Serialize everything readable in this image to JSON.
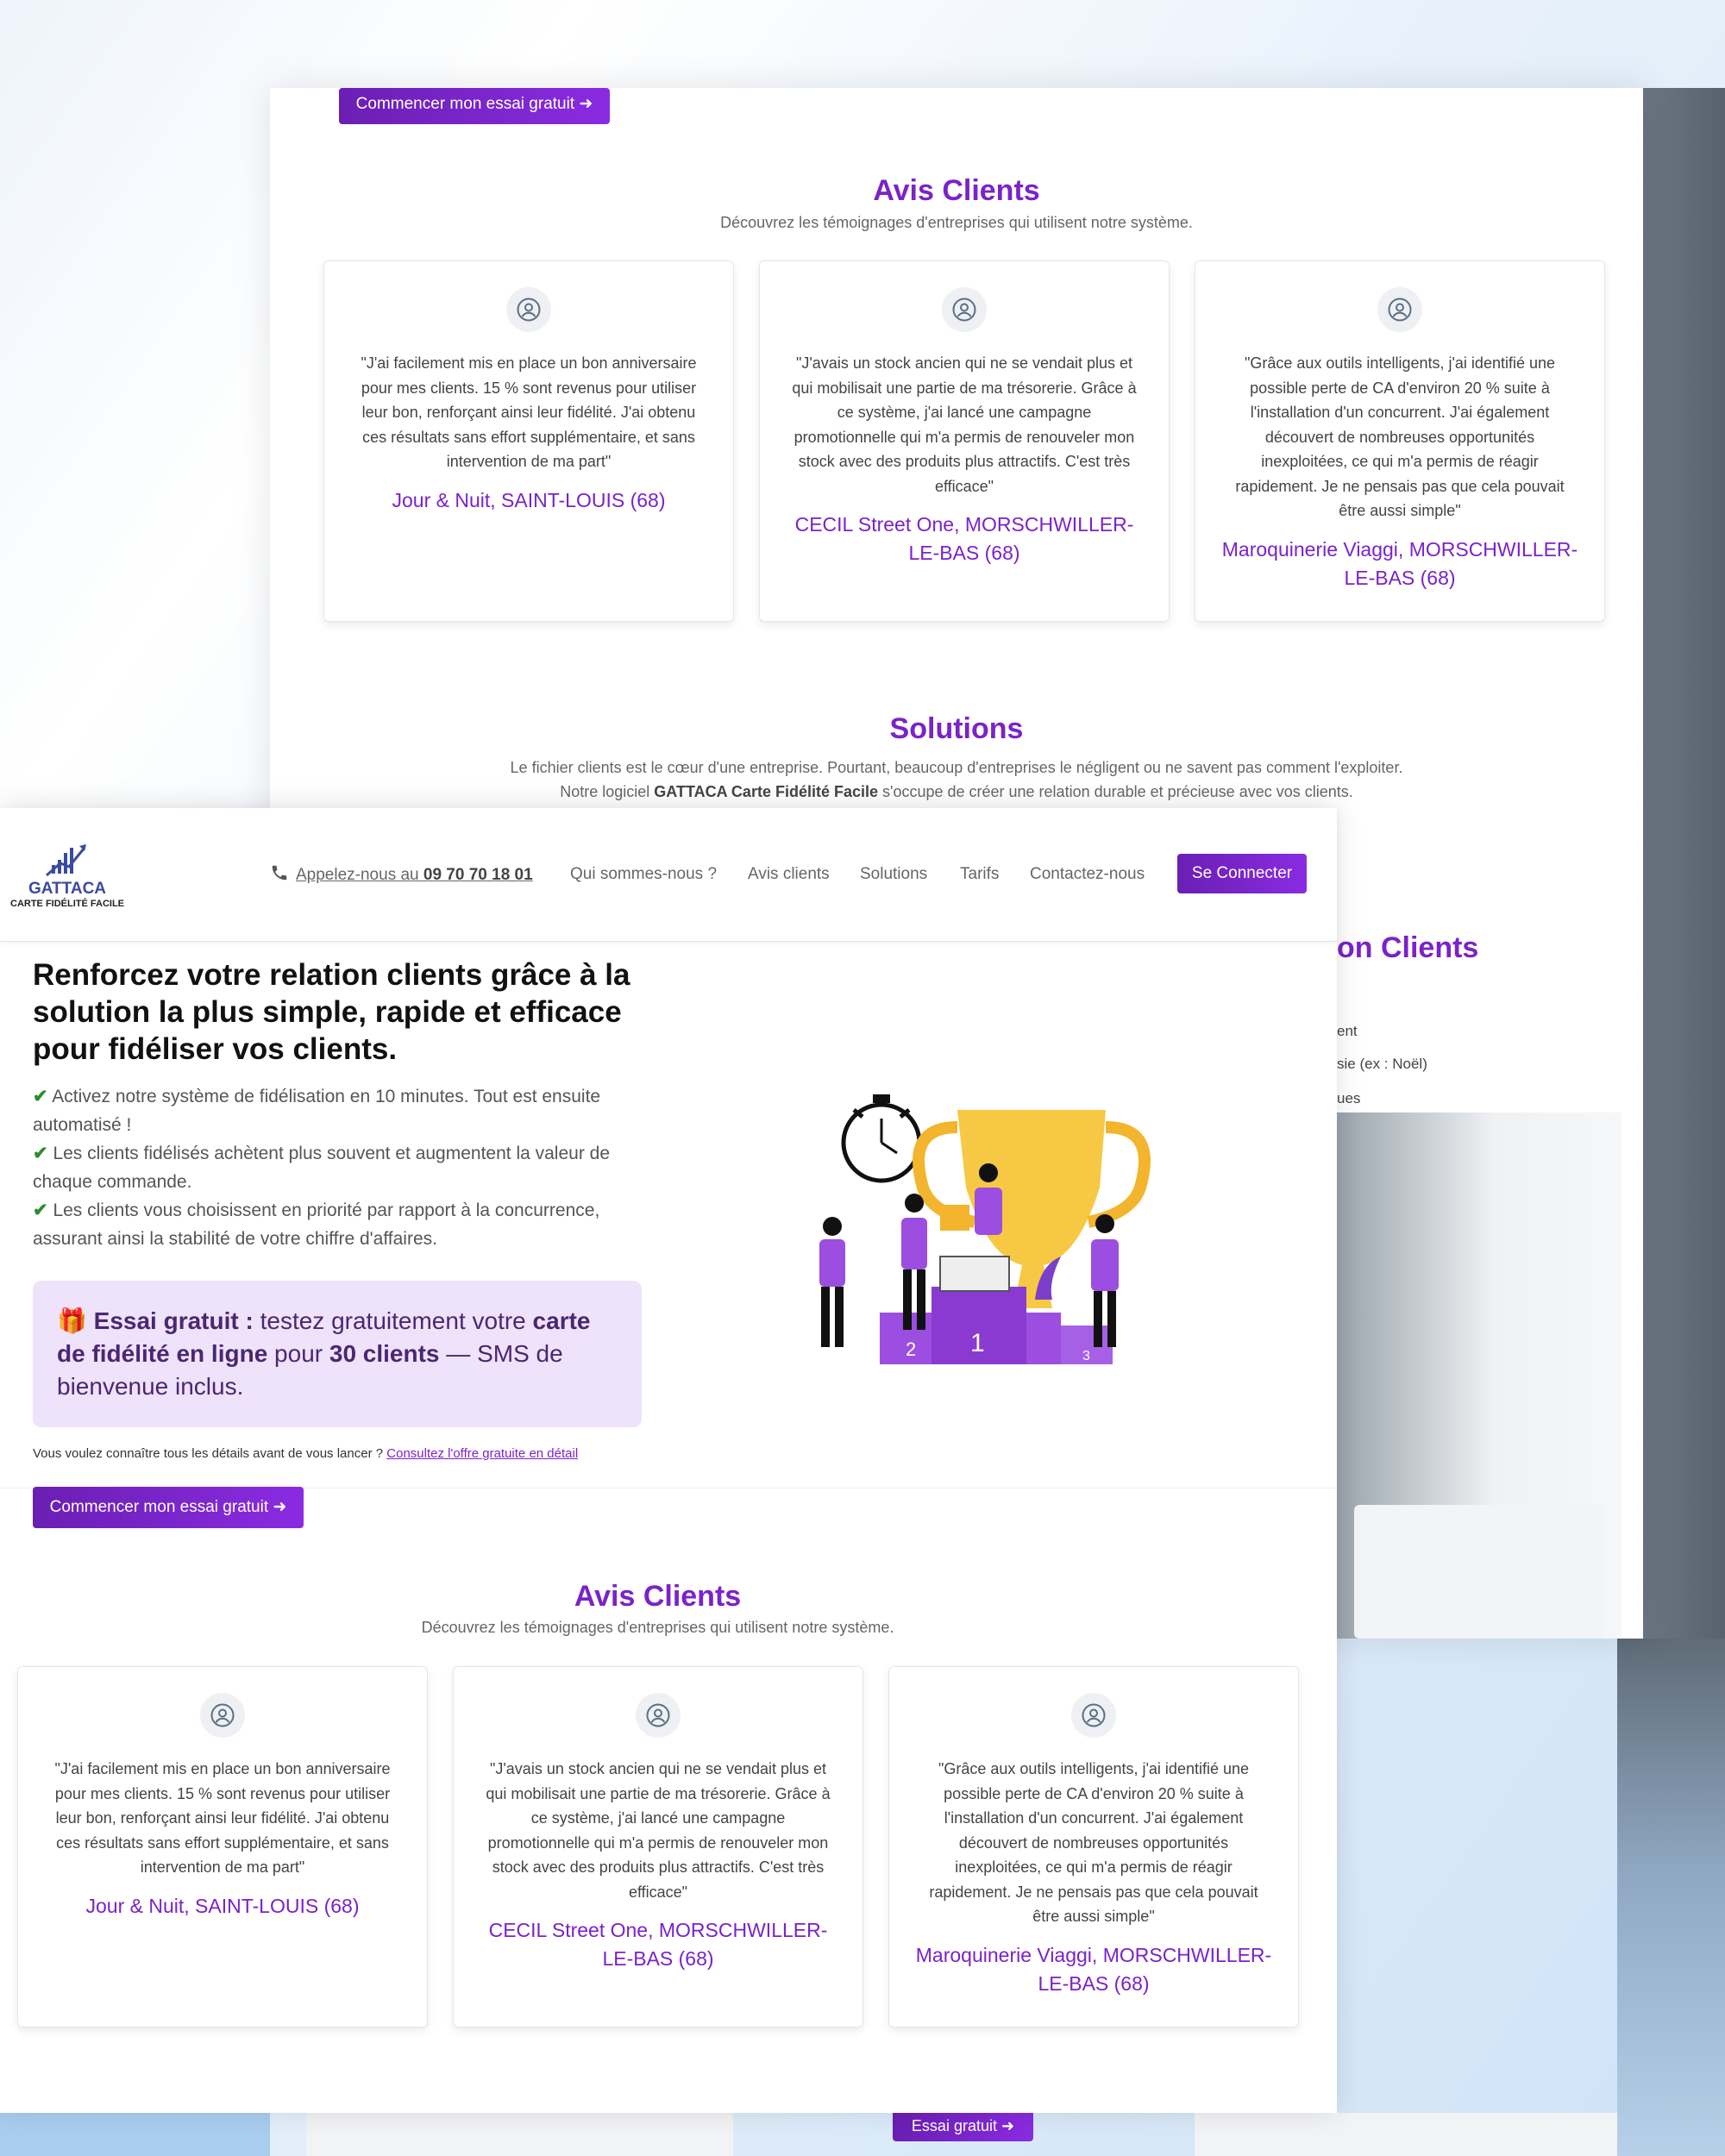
{
  "back_window": {
    "cta_label": "Commencer mon essai gratuit ➜",
    "avis_title": "Avis Clients",
    "avis_sub": "Découvrez les témoignages d'entreprises qui utilisent notre système.",
    "solutions_title": "Solutions",
    "solutions_line1": "Le fichier clients est le cœur d'une entreprise. Pourtant, beaucoup d'entreprises le négligent ou ne savent pas comment l'exploiter.",
    "solutions_line2_pre": "Notre logiciel ",
    "solutions_line2_bold": "GATTACA Carte Fidélité Facile",
    "solutions_line2_post": " s'occupe de créer une relation durable et précieuse avec vos clients.",
    "partial_title": "on Clients",
    "partial_line1": "ent",
    "partial_line2": "sie (ex : Noël)",
    "partial_line3": "ues"
  },
  "testimonials": [
    {
      "quote": "\"J'ai facilement mis en place un bon anniversaire pour mes clients. 15 % sont revenus pour utiliser leur bon, renforçant ainsi leur fidélité. J'ai obtenu ces résultats sans effort supplémentaire, et sans intervention de ma part\"",
      "author": "Jour & Nuit, SAINT-LOUIS (68)"
    },
    {
      "quote": "\"J'avais un stock ancien qui ne se vendait plus et qui mobilisait une partie de ma trésorerie. Grâce à ce système, j'ai lancé une campagne promotionnelle qui m'a permis de renouveler mon stock avec des produits plus attractifs. C'est très efficace\"",
      "author": "CECIL Street One, MORSCHWILLER-LE-BAS (68)"
    },
    {
      "quote": "\"Grâce aux outils intelligents, j'ai identifié une possible perte de CA d'environ 20 % suite à l'installation d'un concurrent. J'ai également découvert de nombreuses opportunités inexploitées, ce qui m'a permis de réagir rapidement. Je ne pensais pas que cela pouvait être aussi simple\"",
      "author": "Maroquinerie Viaggi, MORSCHWILLER-LE-BAS (68)"
    }
  ],
  "header": {
    "logo_name": "GATTACA",
    "logo_sub": "CARTE FIDÉLITÉ FACILE",
    "phone_pre": "Appelez-nous au ",
    "phone_number": "09 70 70 18 01",
    "nav": [
      "Qui sommes-nous ?",
      "Avis clients",
      "Solutions",
      "Tarifs",
      "Contactez-nous"
    ],
    "login": "Se Connecter"
  },
  "hero": {
    "title": "Renforcez votre relation clients grâce à la solution la plus simple, rapide et efficace pour fidéliser vos clients.",
    "features": [
      "Activez notre système de fidélisation en 10 minutes. Tout est ensuite automatisé !",
      "Les clients fidélisés achètent plus souvent et augmentent la valeur de chaque commande.",
      "Les clients vous choisissent en priorité par rapport à la concurrence, assurant ainsi la stabilité de votre chiffre d'affaires."
    ],
    "promo_icon": "🎁",
    "promo_bold1": "Essai gratuit :",
    "promo_text1": " testez gratuitement votre ",
    "promo_bold2": "carte de fidélité en ligne",
    "promo_text2": " pour ",
    "promo_bold3": "30 clients",
    "promo_text3": " — SMS de bienvenue inclus.",
    "details_pre": "Vous voulez connaître tous les détails avant de vous lancer ? ",
    "details_link": "Consultez l'offre gratuite en détail",
    "cta_label": "Commencer mon essai gratuit ➜",
    "illustration": "trophy-team-illustration"
  },
  "front_avis": {
    "title": "Avis Clients",
    "sub": "Découvrez les témoignages d'entreprises qui utilisent notre système."
  },
  "bottom": {
    "cta_label": "Essai gratuit ➜"
  },
  "colors": {
    "accent": "#7b22c9",
    "promo_bg": "#efe2fb",
    "check": "#2f8a2f"
  }
}
